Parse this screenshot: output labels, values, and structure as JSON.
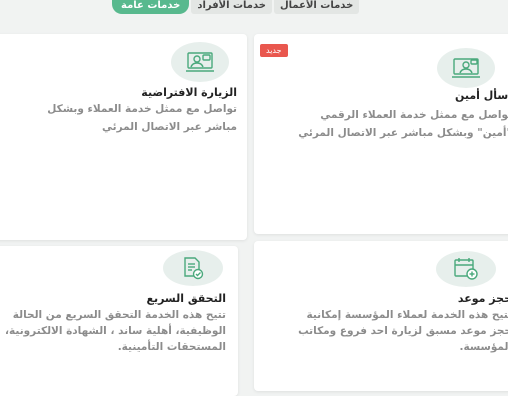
{
  "tabs": [
    {
      "label": "خدمات عامة",
      "active": true
    },
    {
      "label": "خدمات الأفراد",
      "active": false
    },
    {
      "label": "خدمات الأعمال",
      "active": false
    }
  ],
  "cards": {
    "ask_ameen": {
      "badge": "جديد",
      "title": "اسأل أمين",
      "desc1": "تواصل مع ممثل خدمة العملاء الرقمي",
      "desc2": "\"أمين\" وبشكل مباشر عبر الاتصال المرئي",
      "icon": "video-chat-icon"
    },
    "virtual_visit": {
      "title": "الزيارة الافتراضية",
      "desc1": "تواصل مع ممثل خدمة العملاء وبشكل",
      "desc2": "مباشر عبر الاتصال المرئي",
      "icon": "video-call-icon"
    },
    "book_appointment": {
      "title": "حجز موعد",
      "desc1": "تتيح هذه الخدمة لعملاء المؤسسة إمكانية",
      "desc2": "حجز موعد مسبق لزيارة احد فروع ومكاتب",
      "desc3": "المؤسسة.",
      "icon": "calendar-add-icon"
    },
    "quick_check": {
      "title": "التحقق السريع",
      "desc1": "تتيح هذه الخدمة التحقق السريع من الحالة",
      "desc2": "الوظيفية، أهلية ساند ، الشهادة الالكترونية،",
      "desc3": "المستحقات التأمينية.",
      "icon": "document-check-icon"
    }
  },
  "colors": {
    "accent": "#58b98e",
    "badge": "#e9574e",
    "icon_stroke": "#4aa97c"
  }
}
